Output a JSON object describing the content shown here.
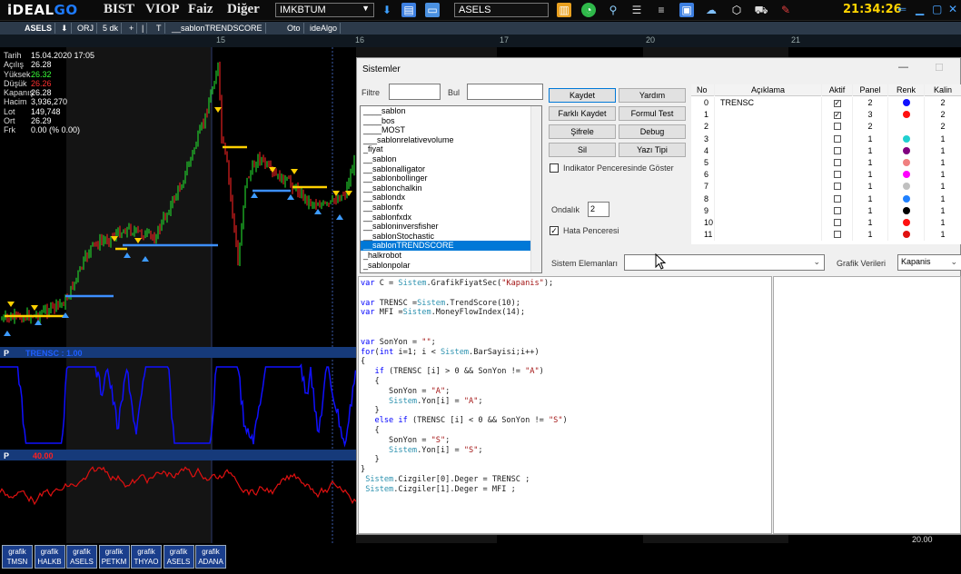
{
  "app": {
    "logo_prefix": "iDEAL",
    "logo_suffix": "GO",
    "menus": [
      "BIST",
      "VIOP",
      "Faiz",
      "Diğer"
    ],
    "market_select": "IMKBTUM",
    "symbol_field": "ASELS",
    "clock": "21:34:26"
  },
  "chart_toolbar": {
    "items": [
      "ASELS",
      "ORJ",
      "5 dk",
      "+",
      "|",
      "T",
      "__sablonTRENDSCORE",
      "Oto",
      "ideAlgo"
    ]
  },
  "date_axis": [
    "15",
    "16",
    "17",
    "20",
    "21"
  ],
  "price_info": {
    "rows": [
      {
        "k": "Tarih",
        "v": "15.04.2020 17:05",
        "color": "#ffffff"
      },
      {
        "k": "Açılış",
        "v": "26.28",
        "color": "#ffffff"
      },
      {
        "k": "Yüksek",
        "v": "26.32",
        "color": "#39ff39"
      },
      {
        "k": "Düşük",
        "v": "26.26",
        "color": "#ff3030"
      },
      {
        "k": "Kapanış",
        "v": "26.28",
        "color": "#ffffff"
      },
      {
        "k": "Hacim",
        "v": "3,936,270",
        "color": "#ffffff"
      },
      {
        "k": "Lot",
        "v": "149,748",
        "color": "#ffffff"
      },
      {
        "k": "Ort",
        "v": "26.29",
        "color": "#ffffff"
      },
      {
        "k": "Frk",
        "v": "0.00 (% 0.00)",
        "color": "#ffffff"
      }
    ]
  },
  "panels": {
    "trend_header_p": "P",
    "trend_header": "TRENSC : 1.00",
    "mfi_header_p": "P",
    "mfi_header": "40.00",
    "mfi_axis_value": "20.00"
  },
  "bottom_tabs": [
    {
      "top": "grafik",
      "bottom": "TMSN"
    },
    {
      "top": "grafik",
      "bottom": "HALKB"
    },
    {
      "top": "grafik",
      "bottom": "ASELS"
    },
    {
      "top": "grafik",
      "bottom": "PETKM"
    },
    {
      "top": "grafik",
      "bottom": "THYAO"
    },
    {
      "top": "grafik",
      "bottom": "ASELS"
    },
    {
      "top": "grafik",
      "bottom": "ADANA"
    }
  ],
  "dialog": {
    "title": "Sistemler",
    "filter_label": "Filtre",
    "find_label": "Bul",
    "systems": [
      "____sablon",
      "____bos",
      "____MOST",
      "___sablonrelativevolume",
      "_fiyat",
      "__sablon",
      "__sablonalligator",
      "__sablonbollinger",
      "__sablonchalkin",
      "__sablondx",
      "__sablonfx",
      "__sablonfxdx",
      "__sabloninversfisher",
      "__sablonStochastic",
      "__sablonTRENDSCORE",
      "_halkrobot",
      "_sablonpolar"
    ],
    "selected_index": 14,
    "buttons": {
      "save": "Kaydet",
      "save_as": "Farklı Kaydet",
      "encrypt": "Şifrele",
      "delete": "Sil",
      "help": "Yardım",
      "formula_test": "Formul Test",
      "debug": "Debug",
      "font": "Yazı Tipi"
    },
    "indicator_window_label": "Indikator Penceresinde Göster",
    "decimal_label": "Ondalık",
    "decimal_value": "2",
    "error_window_label": "Hata Penceresi",
    "system_elements_label": "Sistem Elemanları",
    "chart_data_label": "Grafik Verileri",
    "chart_data_value": "Kapanis",
    "grid_headers": [
      "No",
      "Açıklama",
      "Aktif",
      "Panel",
      "Renk",
      "Kalin"
    ],
    "grid_rows": [
      {
        "no": "0",
        "desc": "TRENSC",
        "active": true,
        "panel": "2",
        "color": "#1010ff",
        "width": "2"
      },
      {
        "no": "1",
        "desc": "",
        "active": true,
        "panel": "3",
        "color": "#ff1010",
        "width": "2"
      },
      {
        "no": "2",
        "desc": "",
        "active": false,
        "panel": "2",
        "color": "",
        "width": "2"
      },
      {
        "no": "3",
        "desc": "",
        "active": false,
        "panel": "1",
        "color": "#20d0d0",
        "width": "1"
      },
      {
        "no": "4",
        "desc": "",
        "active": false,
        "panel": "1",
        "color": "#800080",
        "width": "1"
      },
      {
        "no": "5",
        "desc": "",
        "active": false,
        "panel": "1",
        "color": "#f08080",
        "width": "1"
      },
      {
        "no": "6",
        "desc": "",
        "active": false,
        "panel": "1",
        "color": "#ff00ff",
        "width": "1"
      },
      {
        "no": "7",
        "desc": "",
        "active": false,
        "panel": "1",
        "color": "#c0c0c0",
        "width": "1"
      },
      {
        "no": "8",
        "desc": "",
        "active": false,
        "panel": "1",
        "color": "#2080ff",
        "width": "1"
      },
      {
        "no": "9",
        "desc": "",
        "active": false,
        "panel": "1",
        "color": "#000000",
        "width": "1"
      },
      {
        "no": "10",
        "desc": "",
        "active": false,
        "panel": "1",
        "color": "#ff1010",
        "width": "1"
      },
      {
        "no": "11",
        "desc": "",
        "active": false,
        "panel": "1",
        "color": "#e01010",
        "width": "1"
      }
    ],
    "code": [
      "var C = Sistem.GrafikFiyatSec(\"Kapanis\");",
      "",
      "var TRENSC =Sistem.TrendScore(10);",
      "var MFI =Sistem.MoneyFlowIndex(14);",
      "",
      "",
      "var SonYon = \"\";",
      "for(int i=1; i < Sistem.BarSayisi;i++)",
      "{",
      "   if (TRENSC [i] > 0 && SonYon != \"A\")",
      "   {",
      "      SonYon = \"A\";",
      "      Sistem.Yon[i] = \"A\";",
      "   }",
      "   else if (TRENSC [i] < 0 && SonYon != \"S\")",
      "   {",
      "      SonYon = \"S\";",
      "      Sistem.Yon[i] = \"S\";",
      "   }",
      "}",
      " Sistem.Cizgiler[0].Deger = TRENSC ;",
      " Sistem.Cizgiler[1].Deger = MFI ;"
    ]
  }
}
